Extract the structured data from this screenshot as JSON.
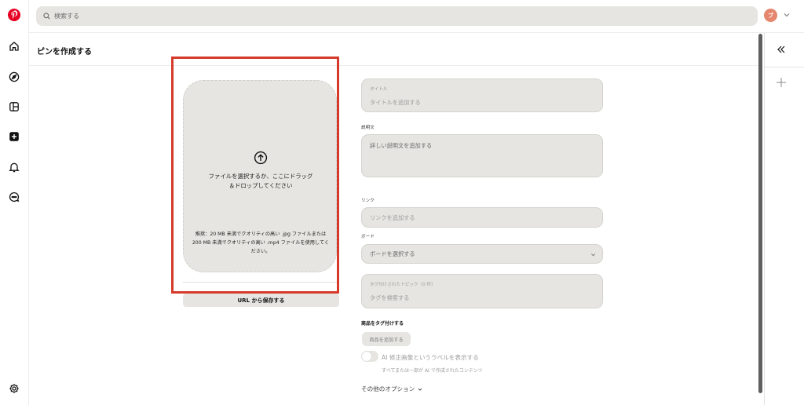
{
  "search": {
    "placeholder": "検索する"
  },
  "account": {
    "avatar_initial": "ブ"
  },
  "page": {
    "title": "ピンを作成する"
  },
  "upload": {
    "message": "ファイルを選択するか、ここにドラッグ＆ドロップしてください",
    "recommendation": "推奨：20 MB 未満でクオリティの高い .jpg ファイルまたは 200 MB 未満でクオリティの高い .mp4 ファイルを使用してください。",
    "url_button": "URL から保存する"
  },
  "form": {
    "title": {
      "label": "タイトル",
      "placeholder": "タイトルを追加する"
    },
    "description": {
      "label": "説明文",
      "placeholder": "詳しい説明文を追加する"
    },
    "link": {
      "label": "リンク",
      "placeholder": "リンクを追加する"
    },
    "board": {
      "label": "ボード",
      "placeholder": "ボードを選択する"
    },
    "tags": {
      "label": "タグ付けされたトピック（0 件）",
      "placeholder": "タグを検索する"
    },
    "products": {
      "label": "商品をタグ付けする",
      "button": "商品を追加する"
    },
    "ai_label": {
      "label": "AI 修正画像というラベルを表示する",
      "sublabel": "すべてまたは一部が AI で作成されたコンテンツ"
    },
    "more_options": "その他のオプション"
  },
  "colors": {
    "brand": "#e60023",
    "highlight": "#d63a2a",
    "field_bg": "#e6e5e1"
  },
  "icons": {
    "rail": [
      "pinterest-logo-icon",
      "home-icon",
      "explore-icon",
      "boards-icon",
      "create-icon",
      "notifications-icon",
      "messages-icon",
      "settings-icon"
    ],
    "top": [
      "search-icon",
      "chevron-down-icon"
    ],
    "panel": [
      "collapse-icon",
      "plus-icon"
    ]
  }
}
